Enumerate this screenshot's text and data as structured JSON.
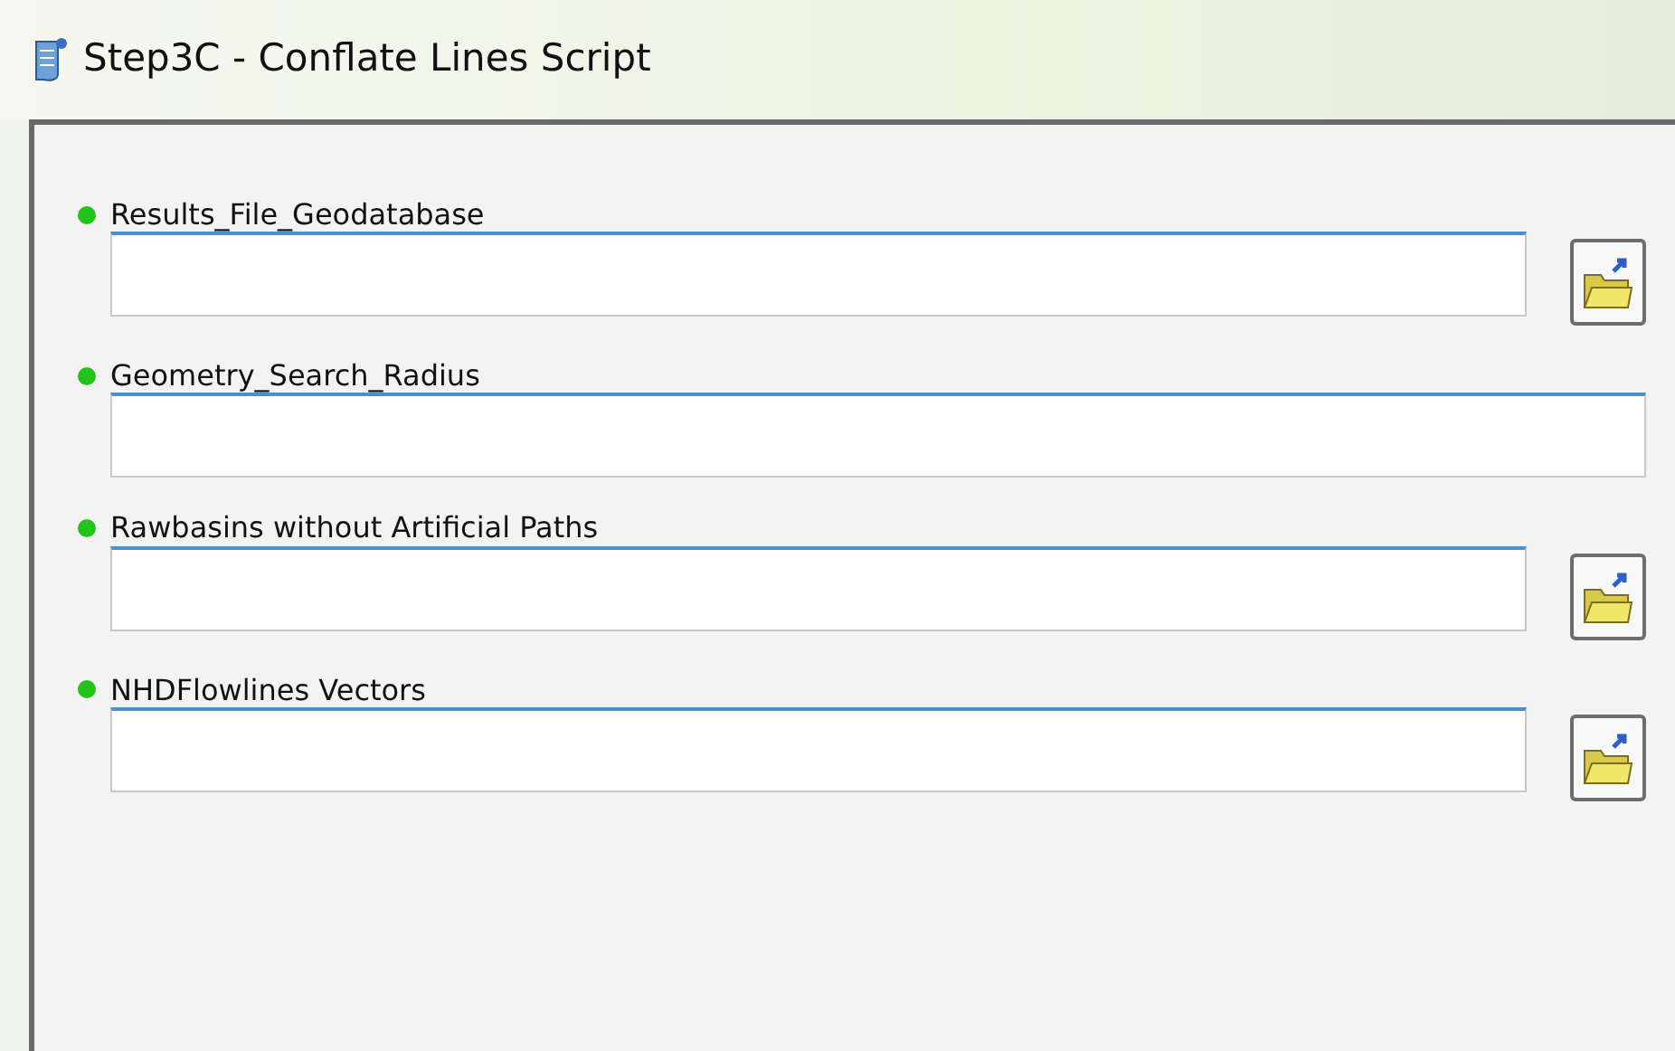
{
  "window": {
    "title": "Step3C - Conflate Lines Script"
  },
  "parameters": [
    {
      "label": "Results_File_Geodatabase",
      "kind": "dataset",
      "required": true
    },
    {
      "label": "Geometry_Search_Radius",
      "kind": "value",
      "required": true
    },
    {
      "label": "Rawbasins without Artificial Paths",
      "kind": "dataset",
      "required": true
    },
    {
      "label": "NHDFlowlines Vectors",
      "kind": "dataset",
      "required": true
    }
  ]
}
